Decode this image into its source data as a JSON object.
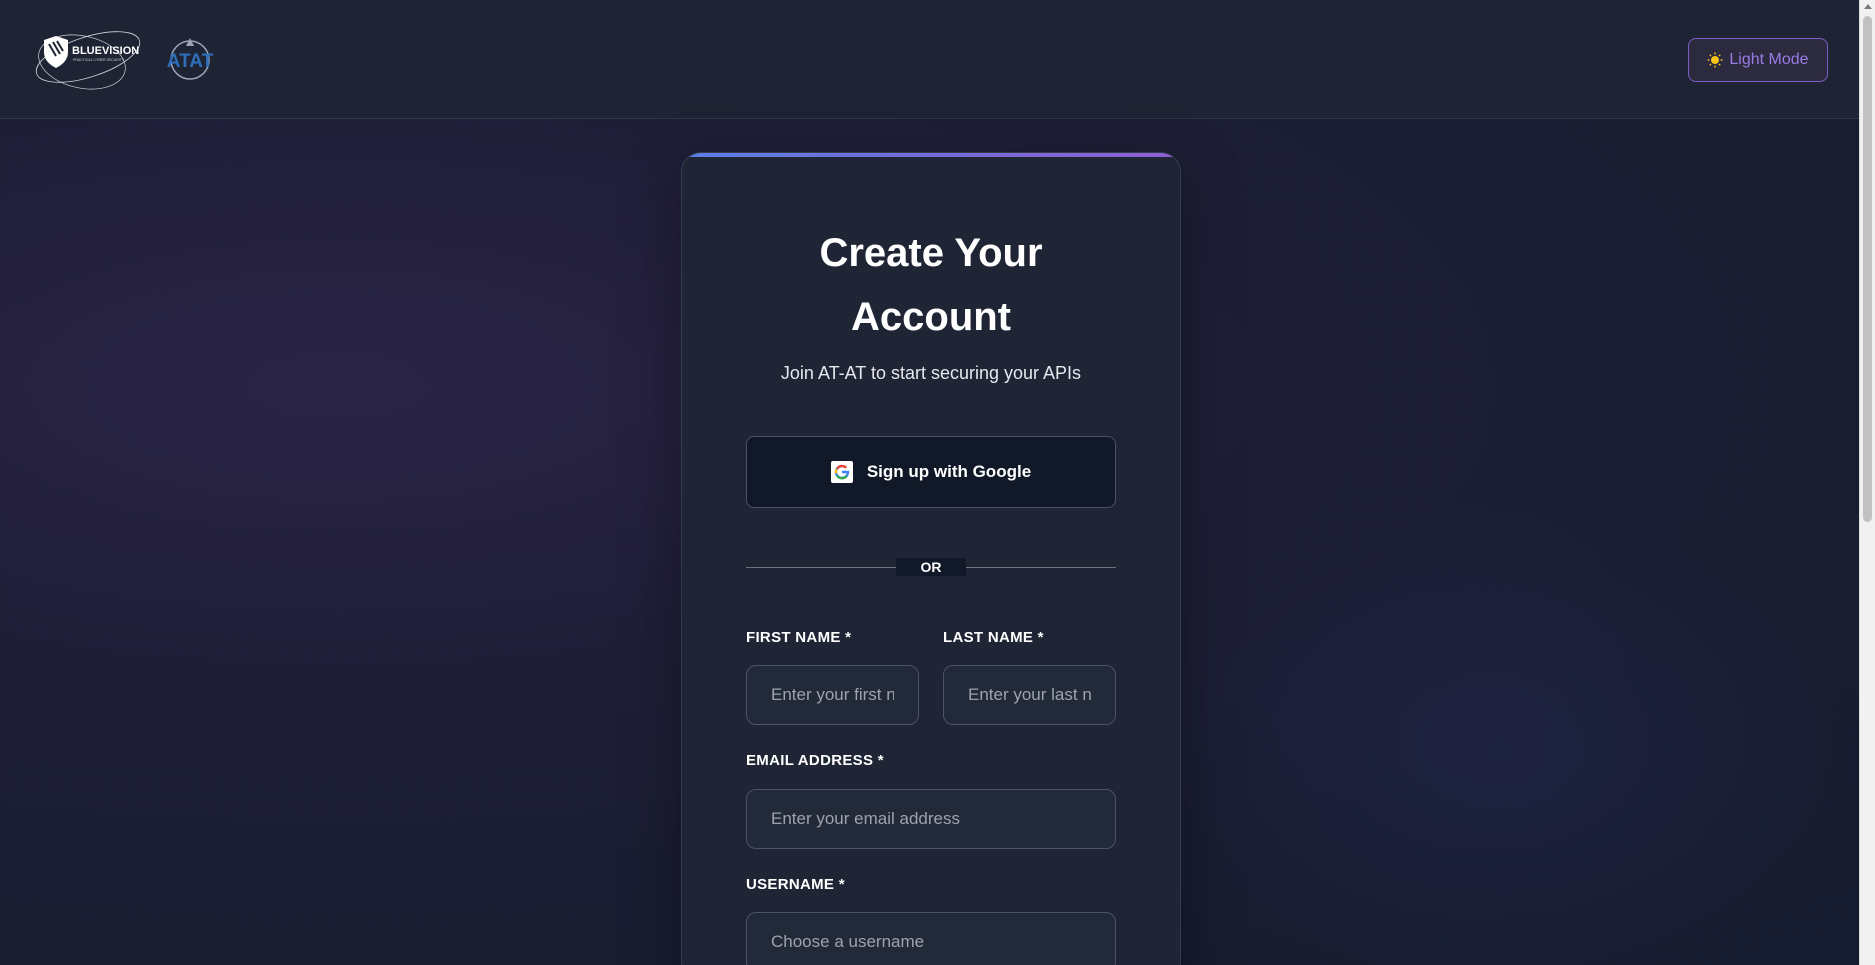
{
  "header": {
    "logo_primary": "BLUEVISION",
    "logo_primary_tagline": "PRACTICAL CYBER SECURITY",
    "logo_secondary": "ATAT",
    "theme_toggle_label": "Light Mode",
    "theme_toggle_icon": "sun-icon"
  },
  "card": {
    "title_line1": "Create Your",
    "title_line2": "Account",
    "subtitle": "Join AT-AT to start securing your APIs",
    "google_button_label": "Sign up with Google",
    "google_button_icon": "google-icon",
    "divider_text": "OR",
    "fields": {
      "first_name": {
        "label": "FIRST NAME *",
        "placeholder": "Enter your first name",
        "value": ""
      },
      "last_name": {
        "label": "LAST NAME *",
        "placeholder": "Enter your last name",
        "value": ""
      },
      "email": {
        "label": "EMAIL ADDRESS *",
        "placeholder": "Enter your email address",
        "value": ""
      },
      "username": {
        "label": "USERNAME *",
        "placeholder": "Choose a username",
        "value": ""
      }
    }
  },
  "colors": {
    "accent_purple": "#8d5fcf",
    "accent_blue": "#5b7ee5",
    "card_bg": "#1f2535",
    "page_bg": "#1c1d33"
  }
}
